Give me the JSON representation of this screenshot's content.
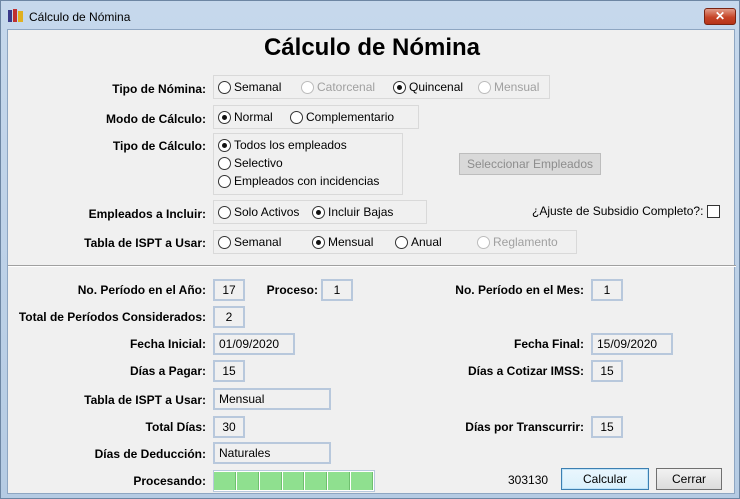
{
  "window": {
    "title": "Cálculo de Nómina",
    "close_glyph": "✕"
  },
  "heading": "Cálculo de Nómina",
  "tipo_nomina": {
    "label": "Tipo de Nómina:",
    "options": [
      {
        "label": "Semanal",
        "checked": false,
        "enabled": true
      },
      {
        "label": "Catorcenal",
        "checked": false,
        "enabled": false
      },
      {
        "label": "Quincenal",
        "checked": true,
        "enabled": true
      },
      {
        "label": "Mensual",
        "checked": false,
        "enabled": false
      }
    ]
  },
  "modo_calculo": {
    "label": "Modo de Cálculo:",
    "options": [
      {
        "label": "Normal",
        "checked": true,
        "enabled": true
      },
      {
        "label": "Complementario",
        "checked": false,
        "enabled": true
      }
    ]
  },
  "tipo_calculo": {
    "label": "Tipo de Cálculo:",
    "options": [
      {
        "label": "Todos los empleados",
        "checked": true,
        "enabled": true
      },
      {
        "label": "Selectivo",
        "checked": false,
        "enabled": true
      },
      {
        "label": "Empleados con incidencias",
        "checked": false,
        "enabled": true
      }
    ],
    "select_button": "Seleccionar Empleados"
  },
  "empleados_incluir": {
    "label": "Empleados a Incluir:",
    "options": [
      {
        "label": "Solo Activos",
        "checked": false,
        "enabled": true
      },
      {
        "label": "Incluir Bajas",
        "checked": true,
        "enabled": true
      }
    ]
  },
  "ajuste_subsidio": {
    "label": "¿Ajuste de Subsidio Completo?:",
    "checked": false
  },
  "tabla_ispt": {
    "label": "Tabla  de ISPT a Usar:",
    "options": [
      {
        "label": "Semanal",
        "checked": false,
        "enabled": true
      },
      {
        "label": "Mensual",
        "checked": true,
        "enabled": true
      },
      {
        "label": "Anual",
        "checked": false,
        "enabled": true
      },
      {
        "label": "Reglamento",
        "checked": false,
        "enabled": false
      }
    ]
  },
  "fields": {
    "periodo_anio": {
      "label": "No. Período en el Año:",
      "value": "17"
    },
    "proceso": {
      "label": "Proceso:",
      "value": "1"
    },
    "periodo_mes": {
      "label": "No. Período en el Mes:",
      "value": "1"
    },
    "total_periodos": {
      "label": "Total de Períodos Considerados:",
      "value": "2"
    },
    "fecha_inicial": {
      "label": "Fecha Inicial:",
      "value": "01/09/2020"
    },
    "fecha_final": {
      "label": "Fecha Final:",
      "value": "15/09/2020"
    },
    "dias_pagar": {
      "label": "Días a Pagar:",
      "value": "15"
    },
    "dias_imss": {
      "label": "Días a Cotizar IMSS:",
      "value": "15"
    },
    "tabla_ispt_usar": {
      "label": "Tabla de ISPT a  Usar:",
      "value": "Mensual"
    },
    "total_dias": {
      "label": "Total Días:",
      "value": "30"
    },
    "dias_transcurrir": {
      "label": "Días por Transcurrir:",
      "value": "15"
    },
    "dias_deduccion": {
      "label": "Días de Deducción:",
      "value": "Naturales"
    }
  },
  "procesando": {
    "label": "Procesando:",
    "progress": 1.0,
    "segments": 7,
    "counter": "303130"
  },
  "buttons": {
    "calcular": "Calcular",
    "cerrar": "Cerrar"
  },
  "colors": {
    "progress": "#8fe08f",
    "title_bar": "#c6d8ec",
    "close": "#c64528"
  }
}
